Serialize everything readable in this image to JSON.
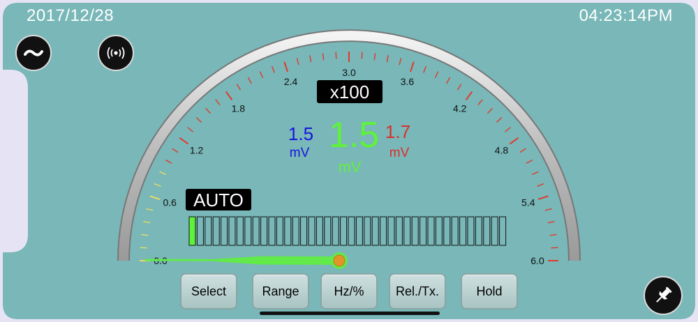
{
  "header": {
    "date": "2017/12/28",
    "time": "04:23:14PM"
  },
  "icons": {
    "ac_mode": "tilde-ac-icon",
    "wireless": "wireless-signal-icon",
    "pin": "pushpin-icon"
  },
  "gauge": {
    "tick_labels": [
      "0.0",
      "0.6",
      "1.2",
      "1.8",
      "2.4",
      "3.0",
      "3.6",
      "4.2",
      "4.8",
      "5.4",
      "6.0"
    ],
    "scale_min": 0,
    "scale_max": 6,
    "needle_value": 0.0,
    "multiplier": "x100",
    "range_mode": "AUTO"
  },
  "reading": {
    "min_value": "1.5",
    "min_unit": "mV",
    "main_value": "1.5",
    "main_unit": "mV",
    "max_value": "1.7",
    "max_unit": "mV"
  },
  "bargraph": {
    "segments_total": 40,
    "segments_lit": 1
  },
  "buttons": {
    "select": "Select",
    "range": "Range",
    "hz": "Hz/%",
    "rel": "Rel./Tx.",
    "hold": "Hold"
  },
  "colors": {
    "background": "#79b7b8",
    "min_value": "#1515dd",
    "main_value": "#5ff23a",
    "max_value": "#d9302a",
    "tick_red": "#e03a2a",
    "tick_yellow": "#e8dd60",
    "needle": "#62e94a",
    "needle_pivot": "#e0952b"
  }
}
